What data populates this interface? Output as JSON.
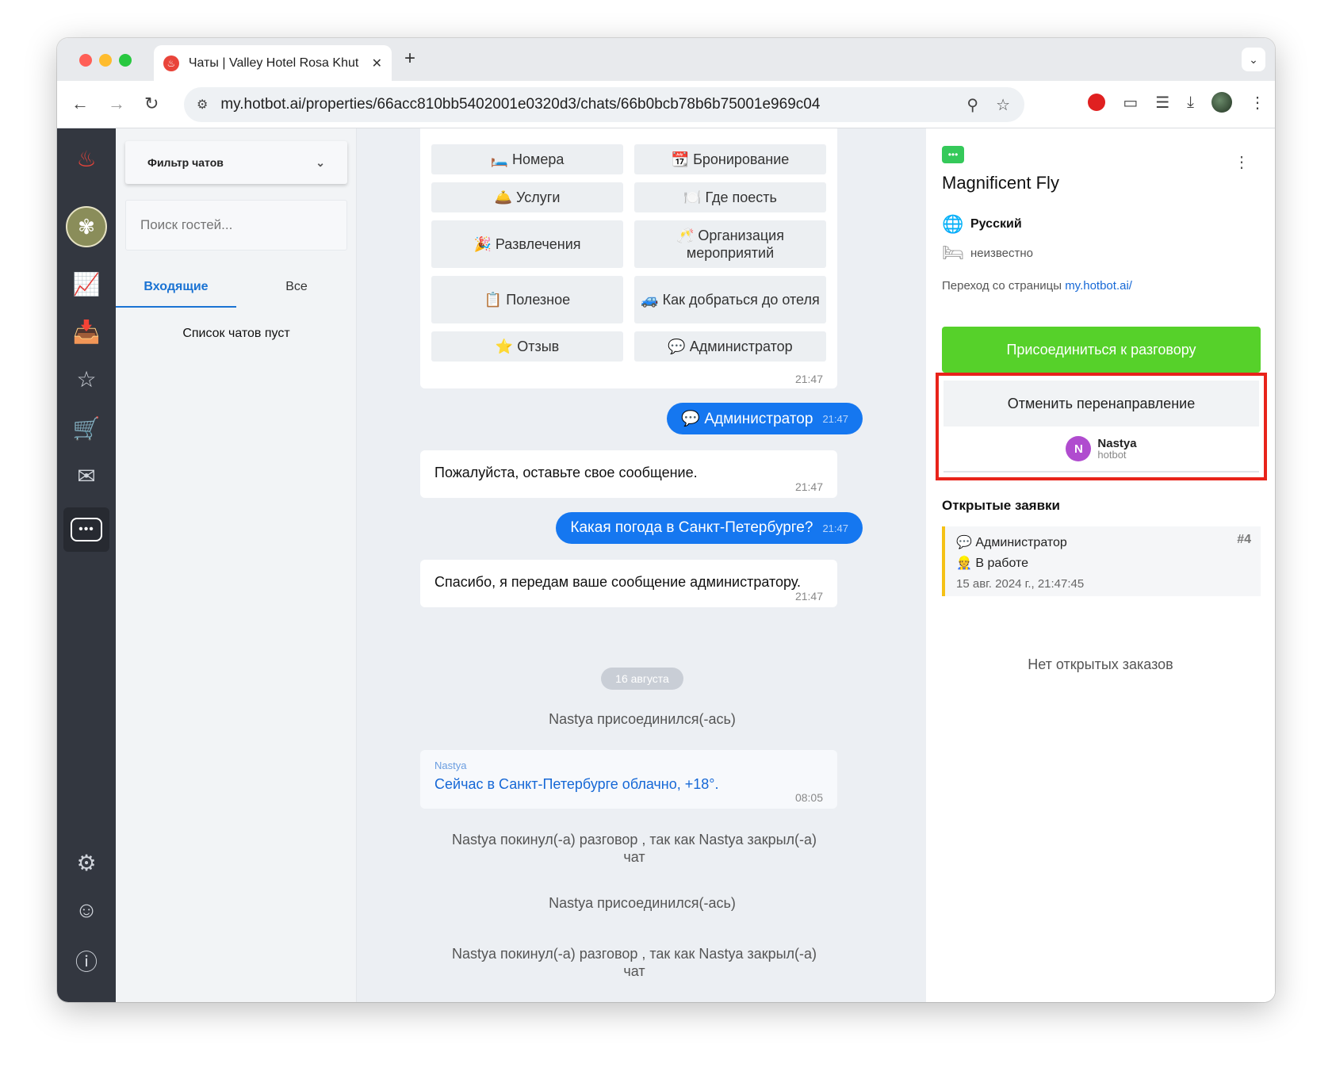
{
  "browser": {
    "tab_title": "Чаты | Valley Hotel Rosa Khut",
    "url": "my.hotbot.ai/properties/66acc810bb5402001e0320d3/chats/66b0bcb78b6b75001e969c04"
  },
  "chat_list": {
    "filter_label": "Фильтр чатов",
    "search_placeholder": "Поиск гостей...",
    "tabs": [
      "Входящие",
      "Все"
    ],
    "empty_text": "Список чатов пуст"
  },
  "menu": {
    "buttons": [
      "🛏️ Номера",
      "📆 Бронирование",
      "🛎️ Услуги",
      "🍽️ Где поесть",
      "🎉 Развлечения",
      "🥂 Организация мероприятий",
      "📋 Полезное",
      "🚙 Как добраться до отеля",
      "⭐ Отзыв",
      "💬 Администратор"
    ],
    "time": "21:47"
  },
  "messages": {
    "out1": {
      "text": "💬 Администратор",
      "time": "21:47"
    },
    "in1": {
      "text": "Пожалуйста, оставьте свое сообщение.",
      "time": "21:47"
    },
    "out2": {
      "text": "Какая погода в Санкт-Петербурге?",
      "time": "21:47"
    },
    "in2": {
      "text": "Спасибо, я передам ваше сообщение администратору.",
      "time": "21:47"
    },
    "date_separator": "16 августа",
    "sys1": "Nastya присоединился(-ась)",
    "agent": {
      "name": "Nastya",
      "text": "Сейчас в Санкт-Петербурге облачно, +18°.",
      "time": "08:05"
    },
    "sys2": "Nastya покинул(-а) разговор , так как Nastya закрыл(-а) чат",
    "sys3": "Nastya присоединился(-ась)",
    "sys4": "Nastya покинул(-а) разговор , так как Nastya закрыл(-а) чат"
  },
  "guest": {
    "name": "Magnificent Fly",
    "language": "Русский",
    "room": "неизвестно",
    "referrer_prefix": "Переход со страницы ",
    "referrer_link": "my.hotbot.ai/",
    "join_button": "Присоединиться к разговору",
    "cancel_redirect": "Отменить перенаправление",
    "operator": {
      "initial": "N",
      "name": "Nastya",
      "sub": "hotbot"
    },
    "open_requests_title": "Открытые заявки",
    "ticket": {
      "type": "💬 Администратор",
      "number": "#4",
      "status": "👷 В работе",
      "date": "15 авг. 2024 г., 21:47:45"
    },
    "no_orders": "Нет открытых заказов"
  },
  "colors": {
    "accent": "#1577f0",
    "join_green": "#56d12a",
    "highlight_red": "#e8231a",
    "rail_bg": "#333740"
  }
}
